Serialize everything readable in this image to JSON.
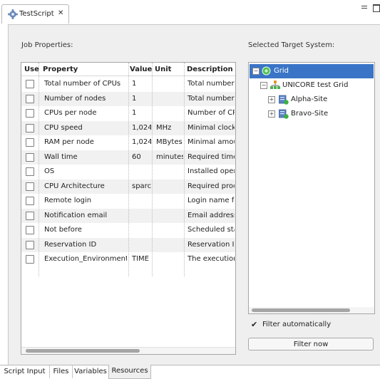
{
  "editor": {
    "tab_title": "TestScript",
    "close_glyph": "✕"
  },
  "job_properties": {
    "label": "Job Properties:",
    "columns": [
      "Use",
      "Property",
      "Value",
      "Unit",
      "Description"
    ],
    "rows": [
      {
        "property": "Total number of CPUs",
        "value": "1",
        "unit": "",
        "description": "Total number"
      },
      {
        "property": "Number of nodes",
        "value": "1",
        "unit": "",
        "description": "Total number"
      },
      {
        "property": "CPUs per node",
        "value": "1",
        "unit": "",
        "description": "Number of CP"
      },
      {
        "property": "CPU speed",
        "value": "1,024",
        "unit": "MHz",
        "description": "Minimal clock"
      },
      {
        "property": "RAM per node",
        "value": "1,024",
        "unit": "MBytes",
        "description": "Minimal amou"
      },
      {
        "property": "Wall time",
        "value": "60",
        "unit": "minutes",
        "description": "Required time"
      },
      {
        "property": "OS",
        "value": "",
        "unit": "",
        "description": "Installed oper:"
      },
      {
        "property": "CPU Architecture",
        "value": "sparc",
        "unit": "",
        "description": "Required proc"
      },
      {
        "property": "Remote login",
        "value": "",
        "unit": "",
        "description": "Login name fo"
      },
      {
        "property": "Notification email",
        "value": "",
        "unit": "",
        "description": "Email address"
      },
      {
        "property": "Not before",
        "value": "",
        "unit": "",
        "description": "Scheduled sta"
      },
      {
        "property": "Reservation ID",
        "value": "",
        "unit": "",
        "description": "Reservation ID"
      },
      {
        "property": "Execution_Environments",
        "value": "TIME",
        "unit": "",
        "description": "The execution"
      }
    ]
  },
  "target_system": {
    "label": "Selected Target System:",
    "tree": [
      {
        "label": "Grid",
        "expander": "−",
        "icon": "grid-globe-icon",
        "selected": true
      },
      {
        "label": "UNICORE test Grid",
        "expander": "−",
        "icon": "network-icon",
        "selected": false
      },
      {
        "label": "Alpha-Site",
        "expander": "+",
        "icon": "site-server-icon",
        "selected": false
      },
      {
        "label": "Bravo-Site",
        "expander": "+",
        "icon": "site-server-icon",
        "selected": false
      }
    ],
    "filter_automatically": {
      "label": "Filter automatically",
      "checked": true
    },
    "filter_now": "Filter now"
  },
  "bottom_tabs": [
    "Script Input",
    "Files",
    "Variables",
    "Resources"
  ],
  "active_tab": "Resources",
  "colors": {
    "selection": "#3a74c6",
    "panel_bg": "#efefef"
  }
}
